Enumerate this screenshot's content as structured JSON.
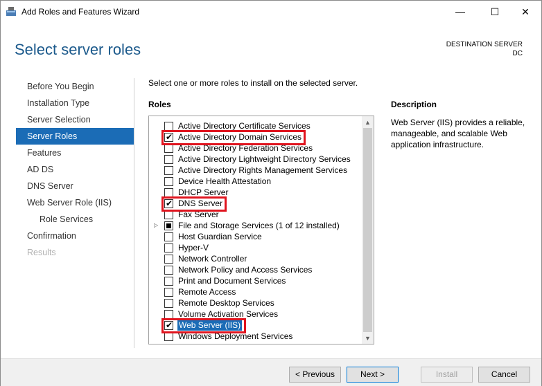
{
  "window": {
    "title": "Add Roles and Features Wizard",
    "minimize_glyph": "—",
    "maximize_glyph": "☐",
    "close_glyph": "✕"
  },
  "header": {
    "page_title": "Select server roles",
    "destination_label": "DESTINATION SERVER",
    "destination_server": "DC"
  },
  "nav": {
    "items": [
      {
        "label": "Before You Begin",
        "state": "normal"
      },
      {
        "label": "Installation Type",
        "state": "normal"
      },
      {
        "label": "Server Selection",
        "state": "normal"
      },
      {
        "label": "Server Roles",
        "state": "active"
      },
      {
        "label": "Features",
        "state": "normal"
      },
      {
        "label": "AD DS",
        "state": "normal"
      },
      {
        "label": "DNS Server",
        "state": "normal"
      },
      {
        "label": "Web Server Role (IIS)",
        "state": "normal"
      },
      {
        "label": "Role Services",
        "state": "sub"
      },
      {
        "label": "Confirmation",
        "state": "normal"
      },
      {
        "label": "Results",
        "state": "disabled"
      }
    ]
  },
  "main": {
    "instruction": "Select one or more roles to install on the selected server.",
    "roles_label": "Roles",
    "roles": [
      {
        "label": "Active Directory Certificate Services",
        "checked": false
      },
      {
        "label": "Active Directory Domain Services",
        "checked": true,
        "highlight": true
      },
      {
        "label": "Active Directory Federation Services",
        "checked": false
      },
      {
        "label": "Active Directory Lightweight Directory Services",
        "checked": false
      },
      {
        "label": "Active Directory Rights Management Services",
        "checked": false
      },
      {
        "label": "Device Health Attestation",
        "checked": false
      },
      {
        "label": "DHCP Server",
        "checked": false
      },
      {
        "label": "DNS Server",
        "checked": true,
        "highlight": true
      },
      {
        "label": "Fax Server",
        "checked": false
      },
      {
        "label": "File and Storage Services (1 of 12 installed)",
        "checked": "partial",
        "expandable": true
      },
      {
        "label": "Host Guardian Service",
        "checked": false
      },
      {
        "label": "Hyper-V",
        "checked": false
      },
      {
        "label": "Network Controller",
        "checked": false
      },
      {
        "label": "Network Policy and Access Services",
        "checked": false
      },
      {
        "label": "Print and Document Services",
        "checked": false
      },
      {
        "label": "Remote Access",
        "checked": false
      },
      {
        "label": "Remote Desktop Services",
        "checked": false
      },
      {
        "label": "Volume Activation Services",
        "checked": false
      },
      {
        "label": "Web Server (IIS)",
        "checked": true,
        "highlight": true,
        "selected": true
      },
      {
        "label": "Windows Deployment Services",
        "checked": false
      }
    ],
    "expander_glyph": "▷",
    "scroll_up_glyph": "▲",
    "scroll_down_glyph": "▼"
  },
  "description": {
    "label": "Description",
    "text": "Web Server (IIS) provides a reliable, manageable, and scalable Web application infrastructure."
  },
  "footer": {
    "previous_label": "< Previous",
    "next_label": "Next >",
    "install_label": "Install",
    "cancel_label": "Cancel"
  },
  "colors": {
    "accent": "#1b6cb6",
    "title_blue": "#1c5a8c",
    "highlight_red": "#e0141e"
  }
}
